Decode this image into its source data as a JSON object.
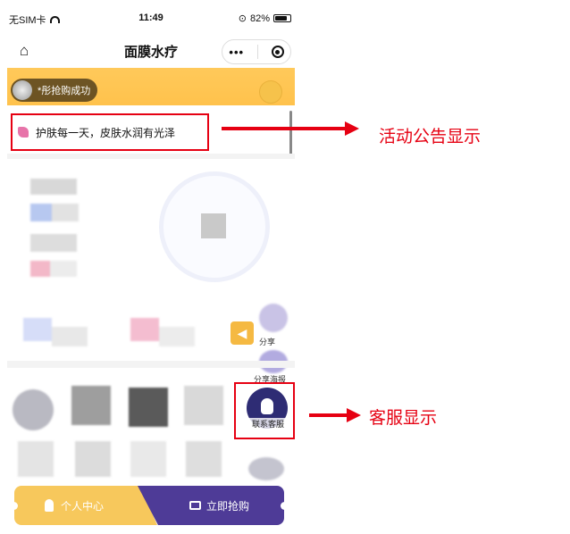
{
  "status_bar": {
    "carrier": "无SIM卡",
    "time": "11:49",
    "battery": "82%",
    "battery_level": 0.82
  },
  "nav": {
    "title": "面膜水疗",
    "capsule_more": "•••"
  },
  "banner": {
    "ticker_text": "*彤抢购成功"
  },
  "notice": {
    "text": "护肤每一天，皮肤水润有光泽"
  },
  "side": {
    "share_label": "分享",
    "poster_label": "分享海报"
  },
  "service": {
    "label": "联系客服"
  },
  "bottom": {
    "personal_center": "个人中心",
    "buy_now": "立即抢购"
  },
  "annotations": {
    "notice_note": "活动公告显示",
    "service_note": "客服显示"
  },
  "colors": {
    "banner": "#ffc95a",
    "highlight_box": "#e60012",
    "buy_button": "#4e3b97",
    "personal_button": "#f7c85c"
  }
}
